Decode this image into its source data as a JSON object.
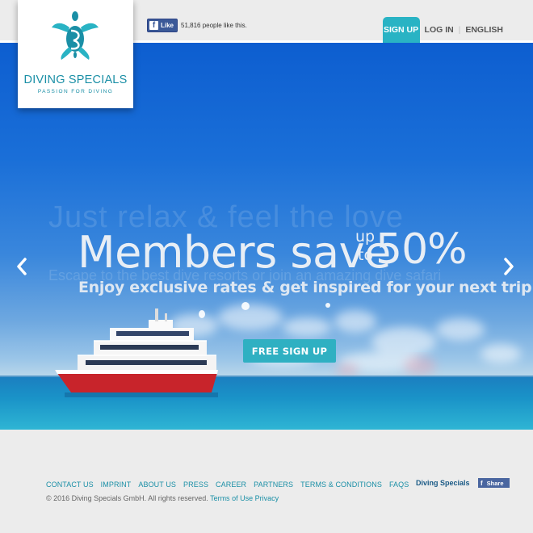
{
  "brand": {
    "name": "DIVING SPECIALS",
    "tagline": "PASSION FOR DIVING",
    "accent_color": "#29b3c4",
    "logo_icon": "turtle-icon"
  },
  "facebook_like": {
    "button_label": "Like",
    "count_text": "51,816 people like this."
  },
  "nav": {
    "signup": "SIGN UP",
    "login": "LOG IN",
    "separator": "|",
    "language": "ENGLISH"
  },
  "hero": {
    "ghost_title": "Just relax & feel the love",
    "ghost_subtitle": "Escape to the best dive resorts or join an amazing dive safari",
    "headline": "Members save",
    "up": "up",
    "to": "to",
    "percent": "50%",
    "subline": "Enjoy exclusive rates & get inspired for your next trip",
    "cta": "FREE SIGN UP",
    "prev_icon": "chevron-left-icon",
    "next_icon": "chevron-right-icon"
  },
  "footer": {
    "links": [
      "CONTACT US",
      "IMPRINT",
      "ABOUT US",
      "PRESS",
      "CAREER",
      "PARTNERS",
      "TERMS & CONDITIONS",
      "FAQS"
    ],
    "copyright": "© 2016 Diving Specials GmbH. All rights reserved.",
    "terms_of_use": "Terms of Use",
    "privacy": "Privacy",
    "brand_label": "Diving Specials",
    "share_label": "Share"
  }
}
